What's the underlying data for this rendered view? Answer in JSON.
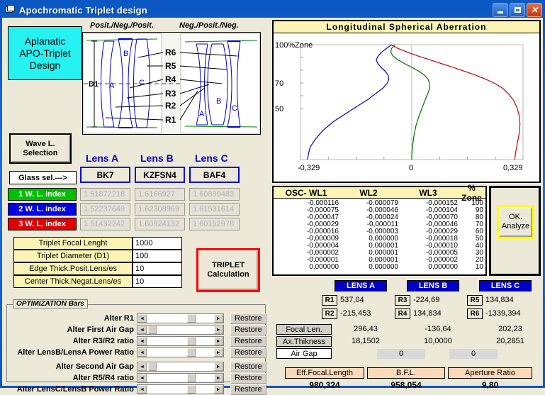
{
  "window": {
    "title": "Apochromatic Triplet design",
    "icon": "application-window-icon",
    "minimize": "–",
    "maximize": "□",
    "close": "✕"
  },
  "banner": {
    "line1": "Aplanatic",
    "line2": "APO-Triplet",
    "line3": "Design"
  },
  "diagram": {
    "header_left": "Posit./Neg./Posit.",
    "header_right": "Neg./Posit./Neg.",
    "d1_label": "D1",
    "radius_labels": [
      "R6",
      "R5",
      "R4",
      "R3",
      "R2",
      "R1"
    ],
    "lens_letters_left": [
      "A",
      "B",
      "C"
    ],
    "lens_letters_right": [
      "A",
      "B",
      "C"
    ]
  },
  "wave_selection_button": {
    "line1": "Wave L.",
    "line2": "Selection"
  },
  "glass_select_button": "Glass sel.--->",
  "lens_columns": {
    "headers": [
      "Lens A",
      "Lens B",
      "Lens C"
    ],
    "glass": [
      "BK7",
      "KZFSN4",
      "BAF4"
    ]
  },
  "wavelength_index": {
    "rows": [
      {
        "label": "1 W. L. index",
        "color": "#00c000",
        "values": [
          "1.51872218",
          "1.6166927",
          "1.60889483"
        ]
      },
      {
        "label": "2 W. L. index",
        "color": "#0000e0",
        "values": [
          "1.52237649",
          "1.62308969",
          "1.61531614"
        ]
      },
      {
        "label": "3 W. L. index",
        "color": "#e00000",
        "values": [
          "1.51432242",
          "1.60924132",
          "1.60152978"
        ]
      }
    ]
  },
  "inputs": [
    {
      "label": "Triplet Focal Lenght",
      "value": "1000"
    },
    {
      "label": "Triplet Diameter  (D1)",
      "value": "100"
    },
    {
      "label": "Edge Thick.Posit.Lens/es",
      "value": "10"
    },
    {
      "label": "Center Thick.Negat.Lens/es",
      "value": "10"
    }
  ],
  "triplet_button": {
    "line1": "TRIPLET",
    "line2": "Calculation"
  },
  "optimization": {
    "title": "OPTIMIZATION Bars",
    "restore_label": "Restore",
    "arrow_left": "◄",
    "arrow_right": "►",
    "rows": [
      {
        "label": "Alter  R1",
        "thumb": 60
      },
      {
        "label": "Alter  First Air Gap",
        "thumb": 2
      },
      {
        "label": "Alter R3/R2  ratio",
        "thumb": 60
      },
      {
        "label": "Alter LensB/LensA Power Ratio",
        "thumb": 60
      },
      {
        "label": "Alter Second Air Gap",
        "thumb": 2
      },
      {
        "label": "Alter R5/R4 ratio",
        "thumb": 60
      },
      {
        "label": "Alter LensC/LensB Power Ratio",
        "thumb": 60
      }
    ]
  },
  "chart_data": {
    "type": "line",
    "title": "Longitudinal  Spherical  Aberration",
    "xlabel": "",
    "ylabel": "",
    "xlim": [
      -0.329,
      0.329
    ],
    "ylim": [
      10,
      100
    ],
    "xticklabels": [
      "-0,329",
      "0",
      "0,329"
    ],
    "yticklabels": [
      "100%Zone",
      "70",
      "50"
    ],
    "grid": false,
    "legend_position": "none",
    "series": [
      {
        "name": "WL2 (blue)",
        "color": "#0000cc",
        "points": [
          [
            -0.06,
            100
          ],
          [
            -0.075,
            97
          ],
          [
            -0.09,
            94
          ],
          [
            -0.1,
            91
          ],
          [
            -0.105,
            88
          ],
          [
            -0.1,
            85
          ],
          [
            -0.09,
            82
          ],
          [
            -0.078,
            79
          ],
          [
            -0.07,
            76
          ],
          [
            -0.068,
            73
          ],
          [
            -0.072,
            70
          ],
          [
            -0.085,
            66
          ],
          [
            -0.105,
            62
          ],
          [
            -0.13,
            57
          ],
          [
            -0.16,
            52
          ],
          [
            -0.195,
            46
          ],
          [
            -0.23,
            40
          ],
          [
            -0.262,
            33
          ],
          [
            -0.285,
            26
          ],
          [
            -0.3,
            20
          ],
          [
            -0.306,
            14
          ],
          [
            -0.308,
            10
          ]
        ]
      },
      {
        "name": "WL1 (green)",
        "color": "#007000",
        "points": [
          [
            -0.05,
            100
          ],
          [
            -0.06,
            97
          ],
          [
            -0.062,
            94
          ],
          [
            -0.055,
            91
          ],
          [
            -0.04,
            88
          ],
          [
            -0.02,
            85
          ],
          [
            0.002,
            82
          ],
          [
            0.022,
            79
          ],
          [
            0.038,
            76
          ],
          [
            0.048,
            73
          ],
          [
            0.052,
            70
          ],
          [
            0.053,
            66
          ],
          [
            0.048,
            62
          ],
          [
            0.04,
            57
          ],
          [
            0.03,
            50
          ],
          [
            0.02,
            43
          ],
          [
            0.012,
            36
          ],
          [
            0.006,
            28
          ],
          [
            0.002,
            20
          ],
          [
            0.0,
            14
          ],
          [
            0.0,
            10
          ]
        ]
      },
      {
        "name": "WL3 (red)",
        "color": "#cc0000",
        "points": [
          [
            -0.062,
            100
          ],
          [
            -0.04,
            97
          ],
          [
            -0.012,
            94
          ],
          [
            0.02,
            91
          ],
          [
            0.055,
            88
          ],
          [
            0.09,
            85
          ],
          [
            0.125,
            82
          ],
          [
            0.158,
            79
          ],
          [
            0.19,
            76
          ],
          [
            0.218,
            73
          ],
          [
            0.243,
            70
          ],
          [
            0.268,
            66
          ],
          [
            0.288,
            61
          ],
          [
            0.302,
            56
          ],
          [
            0.312,
            50
          ],
          [
            0.318,
            44
          ],
          [
            0.32,
            38
          ],
          [
            0.318,
            31
          ],
          [
            0.313,
            24
          ],
          [
            0.308,
            17
          ],
          [
            0.305,
            11
          ],
          [
            0.305,
            10
          ]
        ]
      }
    ]
  },
  "osc_table": {
    "headers": [
      "OSC-  WL1",
      "WL2",
      "WL3",
      "% Zone"
    ],
    "rows": [
      [
        "-0,000116",
        "-0,000079",
        "-0,000152",
        "100"
      ],
      [
        "-0,000075",
        "-0,000046",
        "-0,000104",
        "90"
      ],
      [
        "-0,000047",
        "-0,000024",
        "-0,000070",
        "80"
      ],
      [
        "-0,000029",
        "-0,000011",
        "-0,000046",
        "70"
      ],
      [
        "-0,000016",
        "-0,000003",
        "-0,000029",
        "60"
      ],
      [
        "-0,000009",
        "0,000000",
        "-0,000018",
        "50"
      ],
      [
        "-0,000004",
        "0,000001",
        "-0,000010",
        "40"
      ],
      [
        "-0,000002",
        "0,000001",
        "-0,000005",
        "30"
      ],
      [
        "-0,000001",
        "0,000001",
        "-0,000002",
        "20"
      ],
      [
        "0,000000",
        "0,000000",
        "0,000000",
        "10"
      ]
    ]
  },
  "analyze_button": {
    "line1": "OK.",
    "line2": "Analyze"
  },
  "results": {
    "lens_tags": [
      "LENS A",
      "LENS B",
      "LENS C"
    ],
    "radii": [
      {
        "tag": "R1",
        "value": "537,04"
      },
      {
        "tag": "R2",
        "value": "-215,453"
      },
      {
        "tag": "R3",
        "value": "-224,69"
      },
      {
        "tag": "R4",
        "value": "134,834"
      },
      {
        "tag": "R5",
        "value": "134,834"
      },
      {
        "tag": "R6",
        "value": "-1339,394"
      }
    ],
    "focal_len_label": "Focal Len.",
    "focal_len_values": [
      "296,43",
      "-136,64",
      "202,23"
    ],
    "thickness_label": "Ax.Thikness",
    "thickness_values": [
      "18,1502",
      "10,0000",
      "20,2851"
    ],
    "air_gap_label": "Air Gap",
    "air_gap_values": [
      "0",
      "0"
    ],
    "summary": [
      {
        "label": "Eff.Focal.Length",
        "value": "980,324"
      },
      {
        "label": "B.F.L.",
        "value": "958,054"
      },
      {
        "label": "Aperture Ratio",
        "value": "9,80"
      }
    ]
  }
}
